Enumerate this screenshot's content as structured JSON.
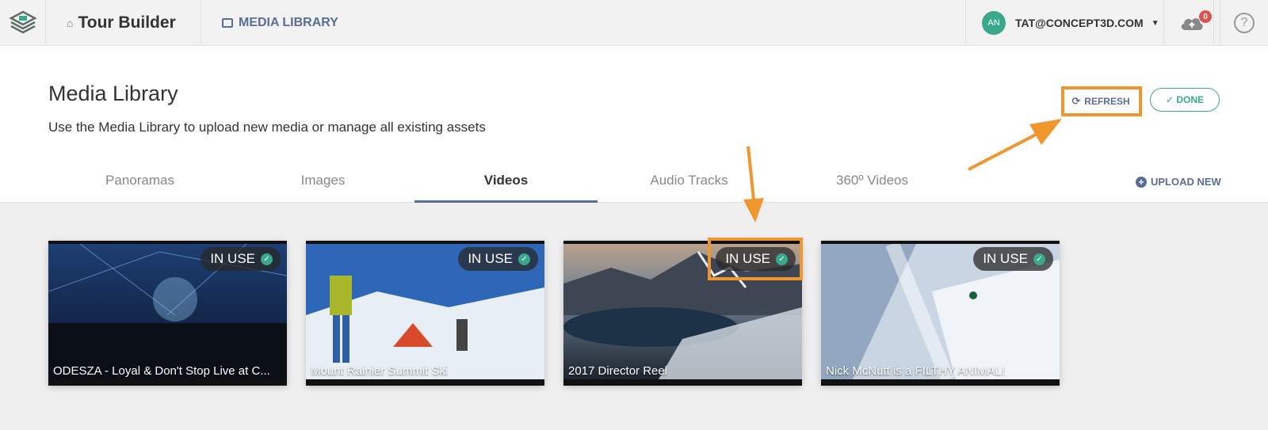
{
  "topbar": {
    "app_title": "Tour Builder",
    "media_library_link": "MEDIA LIBRARY",
    "user_initials": "AN",
    "user_email": "TAT@CONCEPT3D.COM",
    "upload_badge_count": "0"
  },
  "header": {
    "title": "Media Library",
    "subtitle": "Use the Media Library to upload new media or manage all existing assets",
    "refresh_label": "REFRESH",
    "done_label": "✓ DONE",
    "upload_label": "UPLOAD NEW"
  },
  "tabs": [
    {
      "label": "Panoramas",
      "active": false
    },
    {
      "label": "Images",
      "active": false
    },
    {
      "label": "Videos",
      "active": true
    },
    {
      "label": "Audio Tracks",
      "active": false
    },
    {
      "label": "360º Videos",
      "active": false
    }
  ],
  "videos": [
    {
      "status": "IN USE",
      "title": "ODESZA - Loyal & Don't Stop Live at C..."
    },
    {
      "status": "IN USE",
      "title": "Mount Rainier Summit Ski"
    },
    {
      "status": "IN USE",
      "title": "2017 Director Reel"
    },
    {
      "status": "IN USE",
      "title": "Nick McNutt is a FILTHY ANIMAL!"
    }
  ],
  "colors": {
    "accent": "#5a6d9a",
    "success": "#3aa88a",
    "annotation": "#f0962e",
    "badge": "#d9534f"
  },
  "icons": [
    "logo-icon",
    "home-icon",
    "image-icon",
    "caret-down-icon",
    "cloud-upload-icon",
    "help-icon",
    "refresh-icon",
    "plus-circle-icon",
    "check-circle-icon"
  ]
}
